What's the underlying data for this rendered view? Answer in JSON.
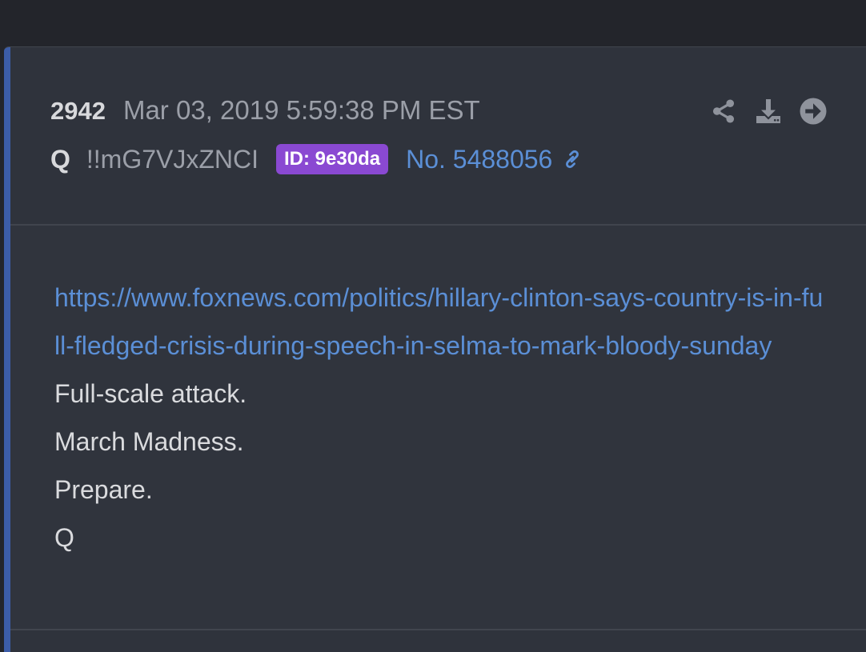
{
  "post": {
    "number": "2942",
    "timestamp": "Mar 03, 2019 5:59:38 PM EST",
    "author": "Q",
    "tripcode": "!!mG7VJxZNCI",
    "id_badge": "ID: 9e30da",
    "post_link": "No. 5488056",
    "body_link": "https://www.foxnews.com/politics/hillary-clinton-says-country-is-in-full-fledged-crisis-during-speech-in-selma-to-mark-bloody-sunday",
    "lines": [
      "Full-scale attack.",
      "March Madness.",
      "Prepare.",
      "Q"
    ]
  },
  "icons": {
    "share": "share-icon",
    "download": "download-icon",
    "goto": "arrow-circle-right-icon",
    "link": "link-icon"
  },
  "colors": {
    "accent_bar": "#3c5da8",
    "id_badge": "#8a49d2",
    "link": "#5b8fd6"
  }
}
